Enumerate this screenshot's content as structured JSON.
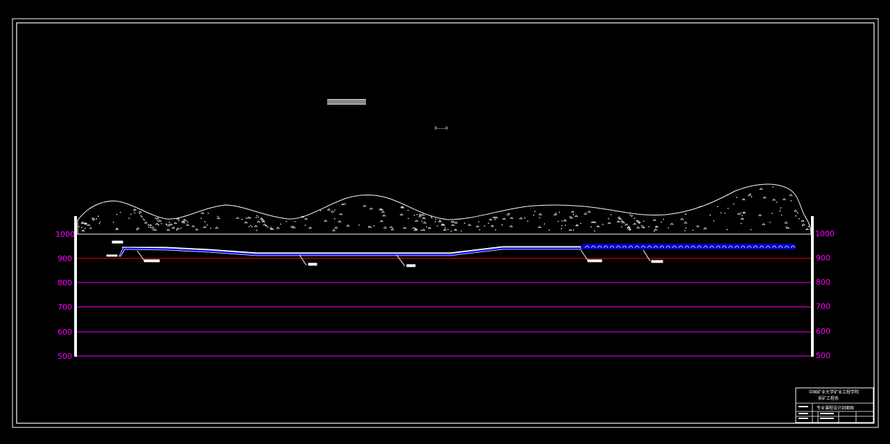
{
  "drawing": {
    "section_label": "II——II",
    "colors": {
      "frame": "#ffffff",
      "elevation_text": "#ff00ff",
      "grid_line": "#ff00ff",
      "coal_seam_line": "#ff0000",
      "roadway": "#0000ff",
      "terrain": "#ffffff"
    },
    "elevations_left": [
      "1000",
      "900",
      "800",
      "700",
      "600",
      "500"
    ],
    "elevations_right": [
      "1000",
      "900",
      "800",
      "700",
      "600",
      "500"
    ]
  },
  "title_block": {
    "org_line1": "中国矿业大学矿业工程学院",
    "org_line2": "采矿工程系",
    "drawing_name": "专业课程设计剖面图"
  }
}
